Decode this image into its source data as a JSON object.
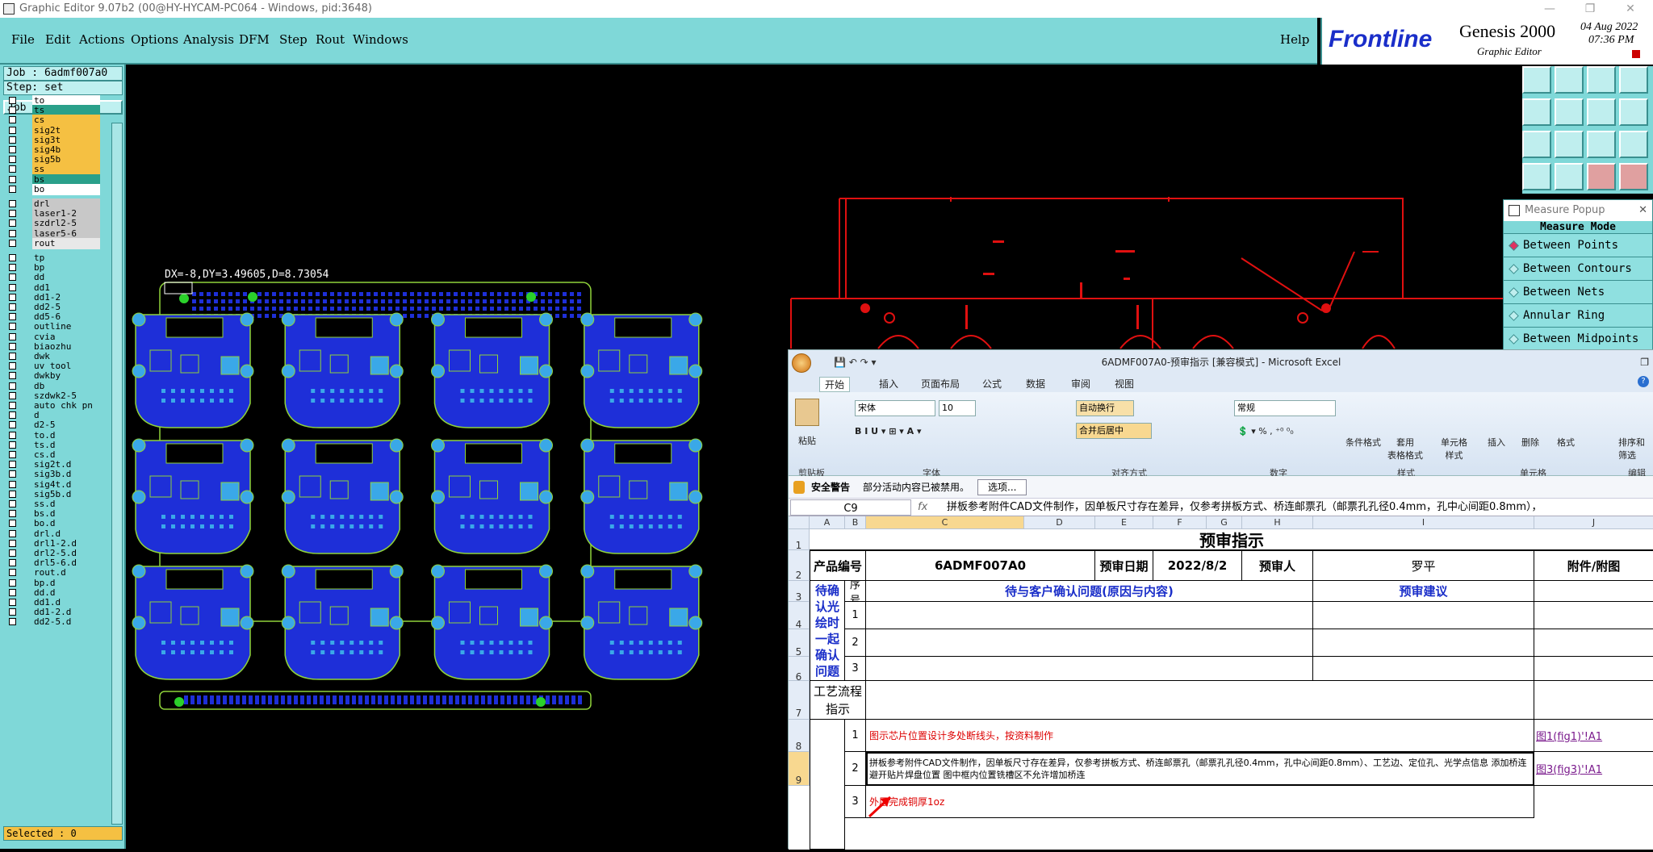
{
  "window": {
    "title": "Graphic Editor 9.07b2 (00@HY-HYCAM-PC064 - Windows, pid:3648)"
  },
  "menu": [
    "File",
    "Edit",
    "Actions",
    "Options",
    "Analysis",
    "DFM",
    "Step",
    "Rout",
    "Windows",
    "Help"
  ],
  "brand": {
    "logo": "Frontline",
    "product": "Genesis 2000",
    "sub": "Graphic Editor",
    "date": "04 Aug 2022",
    "time": "07:36 PM"
  },
  "job": {
    "job_label": "Job : 6admf007a0",
    "step_label": "Step: set",
    "matrix_button": "Job Matrix ..."
  },
  "layers": [
    {
      "name": "to",
      "color": "#ffffff"
    },
    {
      "name": "ts",
      "color": "#2aa08a"
    },
    {
      "name": "cs",
      "color": "#f5c042"
    },
    {
      "name": "sig2t",
      "color": "#f5c042"
    },
    {
      "name": "sig3t",
      "color": "#f5c042"
    },
    {
      "name": "sig4b",
      "color": "#f5c042"
    },
    {
      "name": "sig5b",
      "color": "#f5c042"
    },
    {
      "name": "ss",
      "color": "#f5c042"
    },
    {
      "name": "bs",
      "color": "#2aa08a"
    },
    {
      "name": "bo",
      "color": "#ffffff"
    },
    {
      "name": "drl",
      "color": "#c8c8c8"
    },
    {
      "name": "laser1-2",
      "color": "#c8c8c8"
    },
    {
      "name": "szdrl2-5",
      "color": "#c8c8c8"
    },
    {
      "name": "laser5-6",
      "color": "#c8c8c8"
    },
    {
      "name": "rout",
      "color": "#e8e8e8"
    },
    {
      "name": "tp",
      "color": "#7fd8d8"
    },
    {
      "name": "bp",
      "color": "#7fd8d8"
    },
    {
      "name": "dd",
      "color": "#7fd8d8"
    },
    {
      "name": "dd1",
      "color": "#7fd8d8"
    },
    {
      "name": "dd1-2",
      "color": "#7fd8d8"
    },
    {
      "name": "dd2-5",
      "color": "#7fd8d8"
    },
    {
      "name": "dd5-6",
      "color": "#7fd8d8"
    },
    {
      "name": "outline",
      "color": "#7fd8d8"
    },
    {
      "name": "cvia",
      "color": "#7fd8d8"
    },
    {
      "name": "biaozhu",
      "color": "#7fd8d8"
    },
    {
      "name": "dwk",
      "color": "#7fd8d8"
    },
    {
      "name": "uv_tool",
      "color": "#7fd8d8"
    },
    {
      "name": "dwkby",
      "color": "#7fd8d8"
    },
    {
      "name": "db",
      "color": "#7fd8d8"
    },
    {
      "name": "szdwk2-5",
      "color": "#7fd8d8"
    },
    {
      "name": "auto_chk_pn",
      "color": "#7fd8d8"
    },
    {
      "name": "d",
      "color": "#7fd8d8"
    },
    {
      "name": "d2-5",
      "color": "#7fd8d8"
    },
    {
      "name": "to.d",
      "color": "#7fd8d8"
    },
    {
      "name": "ts.d",
      "color": "#7fd8d8"
    },
    {
      "name": "cs.d",
      "color": "#7fd8d8"
    },
    {
      "name": "sig2t.d",
      "color": "#7fd8d8"
    },
    {
      "name": "sig3b.d",
      "color": "#7fd8d8"
    },
    {
      "name": "sig4t.d",
      "color": "#7fd8d8"
    },
    {
      "name": "sig5b.d",
      "color": "#7fd8d8"
    },
    {
      "name": "ss.d",
      "color": "#7fd8d8"
    },
    {
      "name": "bs.d",
      "color": "#7fd8d8"
    },
    {
      "name": "bo.d",
      "color": "#7fd8d8"
    },
    {
      "name": "drl.d",
      "color": "#7fd8d8"
    },
    {
      "name": "drl1-2.d",
      "color": "#7fd8d8"
    },
    {
      "name": "drl2-5.d",
      "color": "#7fd8d8"
    },
    {
      "name": "drl5-6.d",
      "color": "#7fd8d8"
    },
    {
      "name": "rout.d",
      "color": "#7fd8d8"
    },
    {
      "name": "bp.d",
      "color": "#7fd8d8"
    },
    {
      "name": "dd.d",
      "color": "#7fd8d8"
    },
    {
      "name": "dd1.d",
      "color": "#7fd8d8"
    },
    {
      "name": "dd1-2.d",
      "color": "#7fd8d8"
    },
    {
      "name": "dd2-5.d",
      "color": "#7fd8d8"
    }
  ],
  "selected_label": "Selected : 0",
  "measure_readout": "DX=-8,DY=3.49605,D=8.73054",
  "measure_popup": {
    "title": "Measure Popup",
    "mode_label": "Measure Mode",
    "options": [
      "Between Points",
      "Between Contours",
      "Between Nets",
      "Annular Ring",
      "Between Midpoints"
    ]
  },
  "excel": {
    "title": "6ADMF007A0-预审指示  [兼容模式] - Microsoft Excel",
    "tabs": [
      "开始",
      "插入",
      "页面布局",
      "公式",
      "数据",
      "审阅",
      "视图"
    ],
    "ribbon": {
      "paste": "粘贴",
      "clipboard": "剪贴板",
      "font_name": "宋体",
      "font_size": "10",
      "font": "字体",
      "wrap": "自动换行",
      "merge": "合并后居中",
      "align": "对齐方式",
      "number_format": "常规",
      "number": "数字",
      "cond_format": "条件格式",
      "table_format": "套用\n表格格式",
      "cell_style": "单元格\n样式",
      "style": "样式",
      "insert": "插入",
      "delete": "删除",
      "format": "格式",
      "cells": "单元格",
      "sort": "排序和\n筛选",
      "edit": "编辑"
    },
    "security": {
      "label": "安全警告",
      "message": "部分活动内容已被禁用。",
      "button": "选项..."
    },
    "name_box": "C9",
    "formula": "拼板参考附件CAD文件制作，因单板尺寸存在差异，仅参考拼板方式、桥连邮票孔（邮票孔孔径0.4mm，孔中心间距0.8mm），",
    "columns": [
      "A",
      "B",
      "C",
      "D",
      "E",
      "F",
      "G",
      "H",
      "I",
      "J"
    ],
    "rows": [
      "1",
      "2",
      "3",
      "4",
      "5",
      "6",
      "7",
      "8",
      "9"
    ],
    "sheet": {
      "heading": "预审指示",
      "product_label": "产品编号",
      "product_code": "6ADMF007A0",
      "date_label": "预审日期",
      "date_value": "2022/8/2",
      "reviewer_label": "预审人",
      "reviewer_value": "罗平",
      "attach_label": "附件/附图",
      "seq_label": "序号",
      "confirm_header": "待与客户确认问题(原因与内容)",
      "suggest_header": "预审建议",
      "pending_label": "待确认光绘时一起确认问题",
      "n1": "1",
      "n2": "2",
      "n3": "3",
      "process_label": "工艺流程指示",
      "row8_text": "图示芯片位置设计多处断线头，按资料制作",
      "row8_link": "图1(fig1)'!A1",
      "row9_text": "拼板参考附件CAD文件制作，因单板尺寸存在差异，仅参考拼板方式、桥连邮票孔（邮票孔孔径0.4mm，孔中心间距0.8mm）、工艺边、定位孔、光学点信息   添加桥连避开贴片焊盘位置   图中框内位置铣槽区不允许增加桥连",
      "row9_link": "图3(fig3)'!A1",
      "row10_text": "外层完成铜厚1oz"
    }
  }
}
